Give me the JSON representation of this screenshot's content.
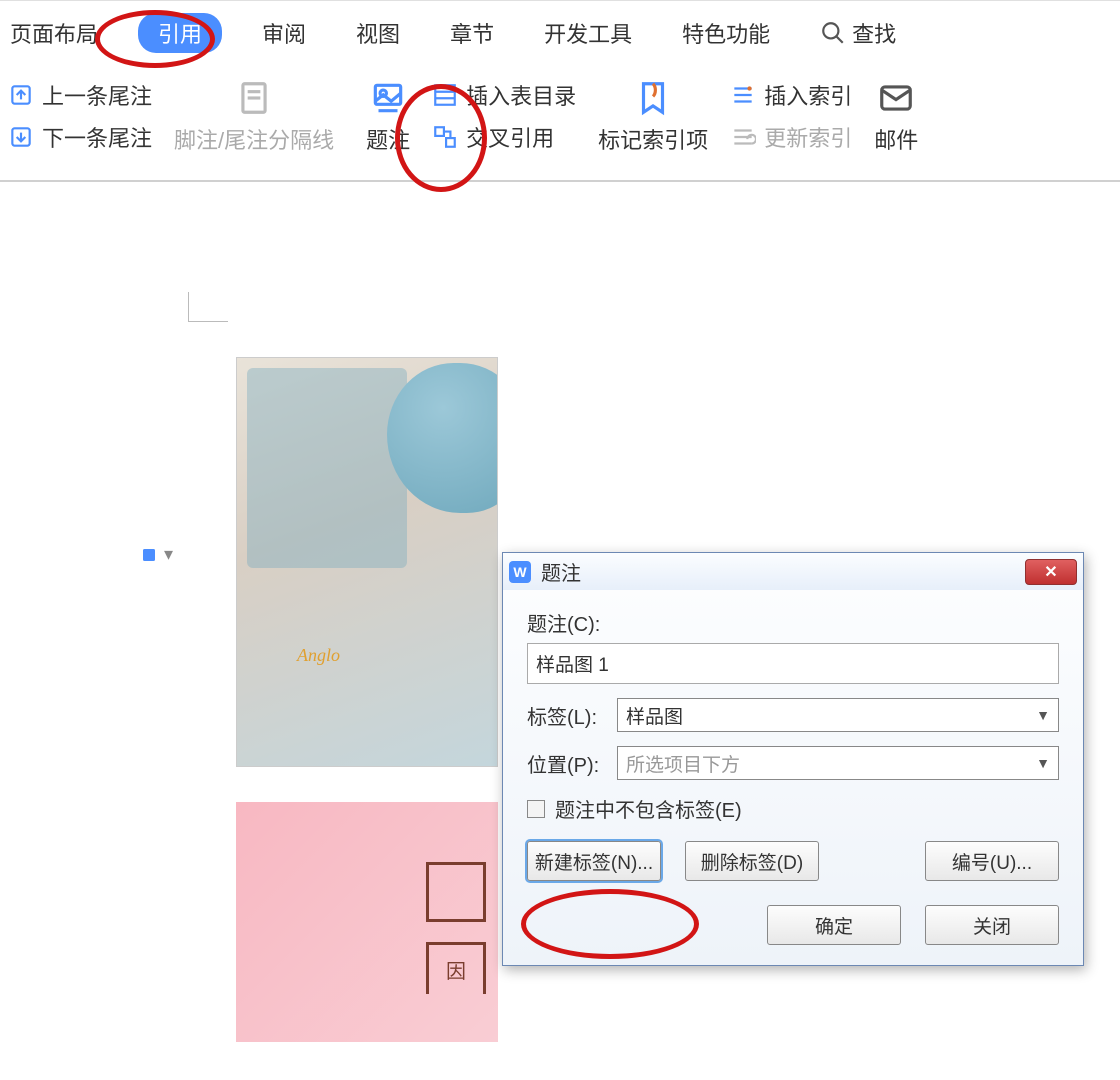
{
  "tabs": {
    "layout": "页面布局",
    "reference": "引用",
    "review": "审阅",
    "view": "视图",
    "section": "章节",
    "devtools": "开发工具",
    "features": "特色功能",
    "search": "查找"
  },
  "ribbon": {
    "prev_endnote": "上一条尾注",
    "next_endnote": "下一条尾注",
    "footnote_sep": "脚注/尾注分隔线",
    "caption": "题注",
    "insert_table_list": "插入表目录",
    "cross_ref": "交叉引用",
    "mark_index": "标记索引项",
    "insert_index": "插入索引",
    "update_index": "更新索引",
    "mail": "邮件"
  },
  "image": {
    "label": "Anglo"
  },
  "pink": {
    "label": "因"
  },
  "dialog": {
    "title": "题注",
    "caption_label": "题注(C):",
    "caption_value": "样品图 1",
    "label_label": "标签(L):",
    "label_value": "样品图",
    "position_label": "位置(P):",
    "position_value": "所选项目下方",
    "exclude_label": "题注中不包含标签(E)",
    "new_label": "新建标签(N)...",
    "delete_label": "删除标签(D)",
    "numbering": "编号(U)...",
    "ok": "确定",
    "close": "关闭"
  }
}
